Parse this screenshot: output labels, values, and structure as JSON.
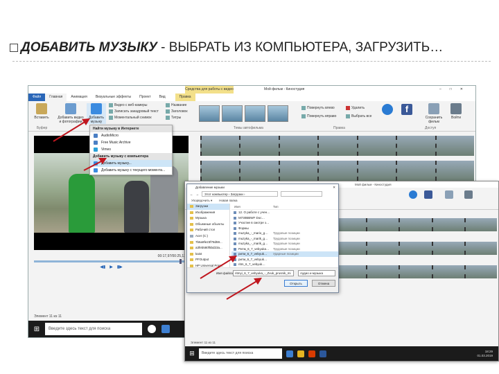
{
  "slide": {
    "title_bold": "ДОБАВИТЬ МУЗЫКУ",
    "title_rest": " - ВЫБРАТЬ ИЗ КОМПЬЮТЕРА, ЗАГРУЗИТЬ…"
  },
  "window": {
    "context_tab": "Средства для работы с видео",
    "title": "Мой фильм - Киностудия",
    "tabs": [
      "Файл",
      "Главная",
      "Анимация",
      "Визуальные эффекты",
      "Проект",
      "Вид"
    ],
    "context_edit_tab": "Правка",
    "ribbon": {
      "paste": "Вставить",
      "add_video": "Добавить видео и фотографии",
      "add_music": "Добавить музыку",
      "webcam": "Видео с веб-камеры",
      "narration": "Записать закадровый текст",
      "snapshot": "Моментальный снимок",
      "caption_title": "Название",
      "caption_heading": "Заголовок",
      "caption_credits": "Титры",
      "rotate_left": "Повернуть влево",
      "rotate_right": "Повернуть вправо",
      "delete": "Удалить",
      "select_all": "Выбрать все",
      "save_movie": "Сохранить фильм",
      "signin": "Войти",
      "group_clipboard": "Буфер",
      "group_themes": "Темы автофильма",
      "group_edit": "Правка",
      "group_share": "Доступ"
    },
    "menu": {
      "header_internet": "Найти музыку в Интернете",
      "internet_items": [
        "AudioMicro",
        "Free Music Archive",
        "Vimeo"
      ],
      "header_pc": "Добавить музыку с компьютера",
      "pc_items": [
        "Добавить музыку...",
        "Добавить музыку с текущего момента..."
      ]
    },
    "player": {
      "time": "00:17,97/00:25,13"
    },
    "status": "Элемент 11 из 11",
    "taskbar_search": "Введите здесь текст для поиска"
  },
  "window2": {
    "title": "Мой фильм - Киностудия",
    "status": "Элемент 11 из 11",
    "taskbar_search": "Введите здесь текст для поиска",
    "clock_time": "18:29",
    "clock_date": "01.03.2019"
  },
  "dialog": {
    "title": "Добавление музыки",
    "path": "Этот компьютер › Загрузки ›",
    "toolbar": [
      "Упорядочить ▾",
      "Новая папка"
    ],
    "nav": [
      "Загрузки",
      "Изображения",
      "Музыка",
      "Объемные объекты",
      "Рабочий стол",
      "Acer (C:)",
      "7b6a9fe23f78d59...",
      "a3feb580f5bd23a...",
      "kaist",
      "PFOutput",
      "HP Universal Print...",
      "nalgus"
    ],
    "col_name": "Имя",
    "col_type": "Тип",
    "files": [
      {
        "name": "12. О работе с учен…",
        "type": ""
      },
      {
        "name": "M730BBWF Doc…",
        "type": ""
      },
      {
        "name": "Участие в смотре з…",
        "type": ""
      },
      {
        "name": "Формы",
        "type": ""
      },
      {
        "name": "muzyka_-_mario_g…",
        "type": "Трудовые позиции"
      },
      {
        "name": "muzyka_-_marik_g…",
        "type": "Трудовые позиции"
      },
      {
        "name": "muzyka_-_marik_g…",
        "type": "Трудовые позиции"
      },
      {
        "name": "Ритм_6_7_vebyuka…",
        "type": "Трудовые позиции"
      },
      {
        "name": "ритм_6_7_vebyuk…",
        "type": "Ударные позиции"
      },
      {
        "name": "ритм_6_7_vebyuk…",
        "type": ""
      },
      {
        "name": "ritm_6_7_vebyuk…",
        "type": ""
      }
    ],
    "filename_label": "Имя файла:",
    "filename_value": "ritmyi_6_7_vebyuka_-_Zvuk_prusnik_mi",
    "filetype": "Аудио и музыка",
    "open": "Открыть",
    "cancel": "Отмена"
  }
}
